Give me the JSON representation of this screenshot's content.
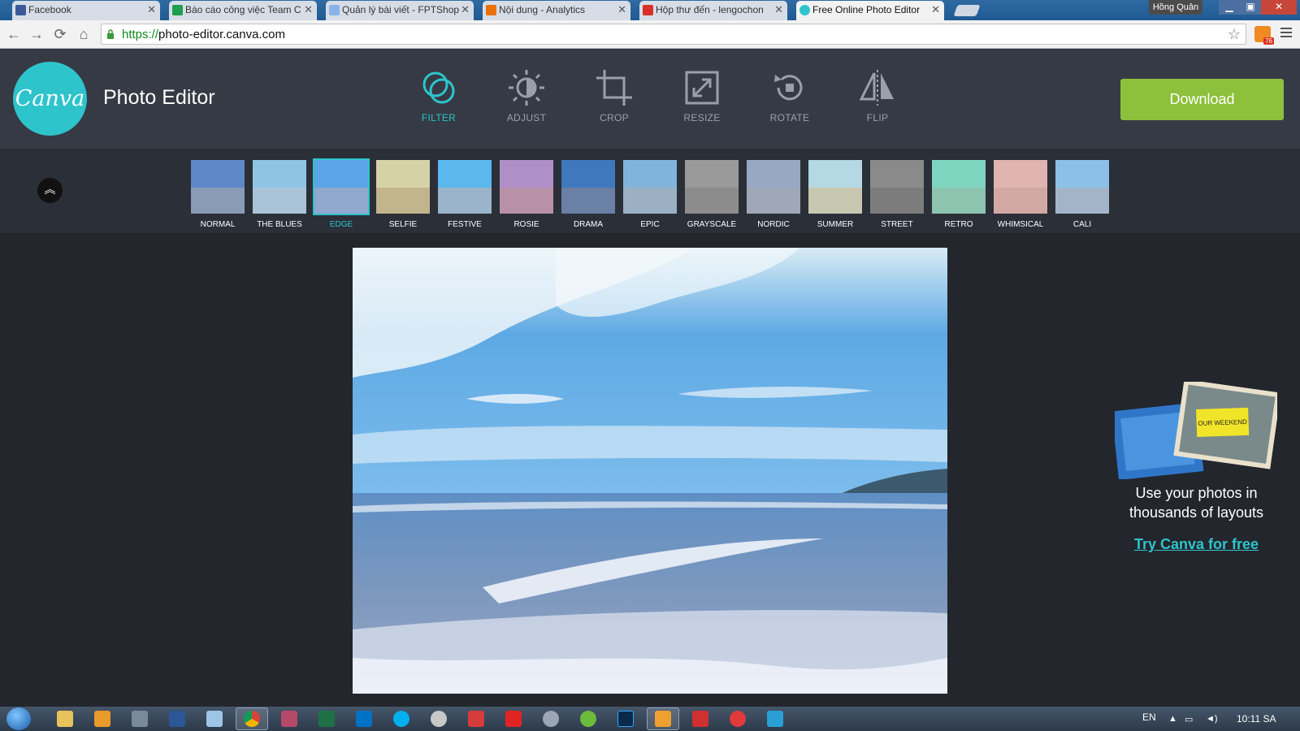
{
  "browser": {
    "tabs": [
      {
        "title": "Facebook",
        "icon": "facebook-icon",
        "color": "#3b5998"
      },
      {
        "title": "Báo cáo công việc Team C",
        "icon": "sheets-icon",
        "color": "#1e9e4f"
      },
      {
        "title": "Quản lý bài viết - FPTShop",
        "icon": "document-icon",
        "color": "#8ab4e8"
      },
      {
        "title": "Nội dung - Analytics",
        "icon": "analytics-icon",
        "color": "#e8710a"
      },
      {
        "title": "Hộp thư đến - lengochon",
        "icon": "gmail-icon",
        "color": "#d93025"
      },
      {
        "title": "Free Online Photo Editor",
        "icon": "canva-icon",
        "color": "#2ec4cc"
      }
    ],
    "user": "Hồng Quân",
    "url_scheme": "https://",
    "url_host": "photo-editor.canva.com",
    "badge_count": "76"
  },
  "app": {
    "logo_text": "Canva",
    "title": "Photo Editor",
    "tools": [
      {
        "label": "FILTER",
        "icon": "filter-icon",
        "active": true
      },
      {
        "label": "ADJUST",
        "icon": "adjust-icon",
        "active": false
      },
      {
        "label": "CROP",
        "icon": "crop-icon",
        "active": false
      },
      {
        "label": "RESIZE",
        "icon": "resize-icon",
        "active": false
      },
      {
        "label": "ROTATE",
        "icon": "rotate-icon",
        "active": false
      },
      {
        "label": "FLIP",
        "icon": "flip-icon",
        "active": false
      }
    ],
    "download_label": "Download",
    "accent": "#2ec4cc",
    "download_color": "#8dc03b"
  },
  "filters": [
    {
      "label": "NORMAL",
      "sky": "#5f88c8",
      "sea": "#8a9bb8"
    },
    {
      "label": "THE BLUES",
      "sky": "#8fc4e4",
      "sea": "#a8c4d6"
    },
    {
      "label": "EDGE",
      "sky": "#5aa6e6",
      "sea": "#8fa8cc",
      "active": true
    },
    {
      "label": "SELFIE",
      "sky": "#d6d2a8",
      "sea": "#c2b48c"
    },
    {
      "label": "FESTIVE",
      "sky": "#5ab8ee",
      "sea": "#9ab4cc"
    },
    {
      "label": "ROSIE",
      "sky": "#b08ec8",
      "sea": "#b890a8"
    },
    {
      "label": "DRAMA",
      "sky": "#3f78bc",
      "sea": "#6a80a4"
    },
    {
      "label": "EPIC",
      "sky": "#80b4dc",
      "sea": "#9cb0c4"
    },
    {
      "label": "GRAYSCALE",
      "sky": "#9a9a9a",
      "sea": "#8c8c8c"
    },
    {
      "label": "NORDIC",
      "sky": "#98a8c4",
      "sea": "#a0a8b8"
    },
    {
      "label": "SUMMER",
      "sky": "#b4d8e4",
      "sea": "#c8c8b0"
    },
    {
      "label": "STREET",
      "sky": "#8a8a8a",
      "sea": "#7c7c7c"
    },
    {
      "label": "RETRO",
      "sky": "#7ed6c0",
      "sea": "#8cc4b0"
    },
    {
      "label": "WHIMSICAL",
      "sky": "#e0b4b0",
      "sea": "#d2a8a4"
    },
    {
      "label": "CALI",
      "sky": "#8cc0e8",
      "sea": "#a4b4c8"
    }
  ],
  "promo": {
    "text": "Use your photos in thousands of layouts",
    "link": "Try Canva for free",
    "card_text": "OUR WEEKEND"
  },
  "taskbar": {
    "language": "EN",
    "time": "10:11 SA"
  }
}
